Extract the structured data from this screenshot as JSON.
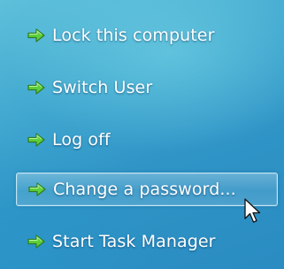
{
  "options": [
    {
      "label": "Lock this computer",
      "icon": "green-arrow-icon"
    },
    {
      "label": "Switch User",
      "icon": "green-arrow-icon"
    },
    {
      "label": "Log off",
      "icon": "green-arrow-icon"
    },
    {
      "label": "Change a password...",
      "icon": "green-arrow-icon",
      "hovered": true
    },
    {
      "label": "Start Task Manager",
      "icon": "green-arrow-icon"
    }
  ],
  "colors": {
    "background": "#3fa6cf",
    "text": "#ffffff",
    "arrow": "#5fcf3a"
  }
}
